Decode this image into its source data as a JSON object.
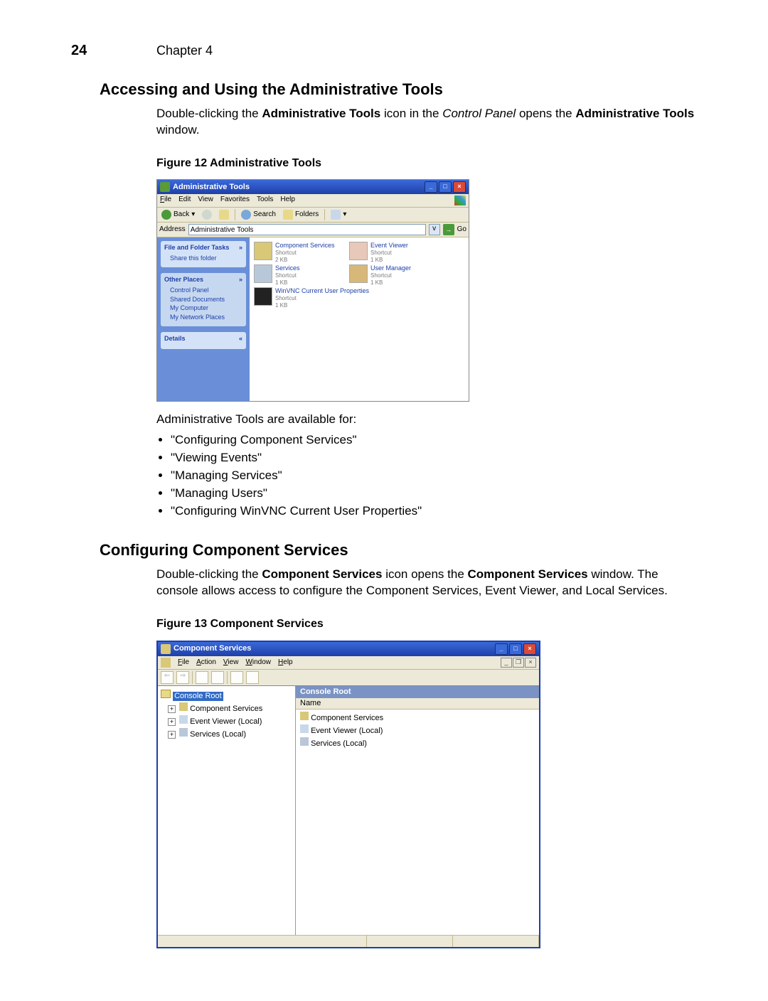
{
  "page_number": "24",
  "chapter_label": "Chapter 4",
  "section1_title": "Accessing and Using the Administrative Tools",
  "intro1_pre": "Double-clicking the ",
  "intro1_bold1": "Administrative Tools",
  "intro1_mid": " icon in the ",
  "intro1_ital": "Control Panel",
  "intro1_post": " opens the ",
  "intro1_bold2": "Administrative Tools",
  "intro1_end": " window.",
  "fig12_caption": "Figure 12   Administrative Tools",
  "shot1": {
    "title": "Administrative Tools",
    "menu": {
      "file": "File",
      "edit": "Edit",
      "view": "View",
      "favorites": "Favorites",
      "tools": "Tools",
      "help": "Help"
    },
    "toolbar": {
      "back": "Back",
      "search": "Search",
      "folders": "Folders"
    },
    "address_label": "Address",
    "address_value": "Administrative Tools",
    "go_label": "Go",
    "side_group1_head": "File and Folder Tasks",
    "side_group1_item1": "Share this folder",
    "side_group2_head": "Other Places",
    "side_group2_item1": "Control Panel",
    "side_group2_item2": "Shared Documents",
    "side_group2_item3": "My Computer",
    "side_group2_item4": "My Network Places",
    "side_group3_head": "Details",
    "icons": [
      {
        "name": "Component Services",
        "sub1": "Shortcut",
        "sub2": "2 KB"
      },
      {
        "name": "Event Viewer",
        "sub1": "Shortcut",
        "sub2": "1 KB"
      },
      {
        "name": "Services",
        "sub1": "Shortcut",
        "sub2": "1 KB"
      },
      {
        "name": "User Manager",
        "sub1": "Shortcut",
        "sub2": "1 KB"
      },
      {
        "name": "WinVNC Current User Properties",
        "sub1": "Shortcut",
        "sub2": "1 KB"
      }
    ]
  },
  "after_fig1_lead": "Administrative Tools are available for:",
  "bullets": [
    "\"Configuring Component Services\"",
    "\"Viewing Events\"",
    "\"Managing Services\"",
    "\"Managing Users\"",
    "\"Configuring WinVNC Current User Properties\""
  ],
  "section2_title": "Configuring Component Services",
  "intro2_pre": "Double-clicking the ",
  "intro2_bold1": "Component Services",
  "intro2_mid": " icon opens the ",
  "intro2_bold2": "Component Services",
  "intro2_post": " window. The console allows access to configure the Component Services, Event Viewer, and Local Services.",
  "fig13_caption": "Figure 13   Component Services",
  "shot2": {
    "title": "Component Services",
    "menu": {
      "file": "File",
      "action": "Action",
      "view": "View",
      "window": "Window",
      "help": "Help"
    },
    "tree_root": "Console Root",
    "tree_items": [
      "Component Services",
      "Event Viewer (Local)",
      "Services (Local)"
    ],
    "list_header": "Console Root",
    "list_col": "Name",
    "list_items": [
      "Component Services",
      "Event Viewer (Local)",
      "Services (Local)"
    ]
  }
}
